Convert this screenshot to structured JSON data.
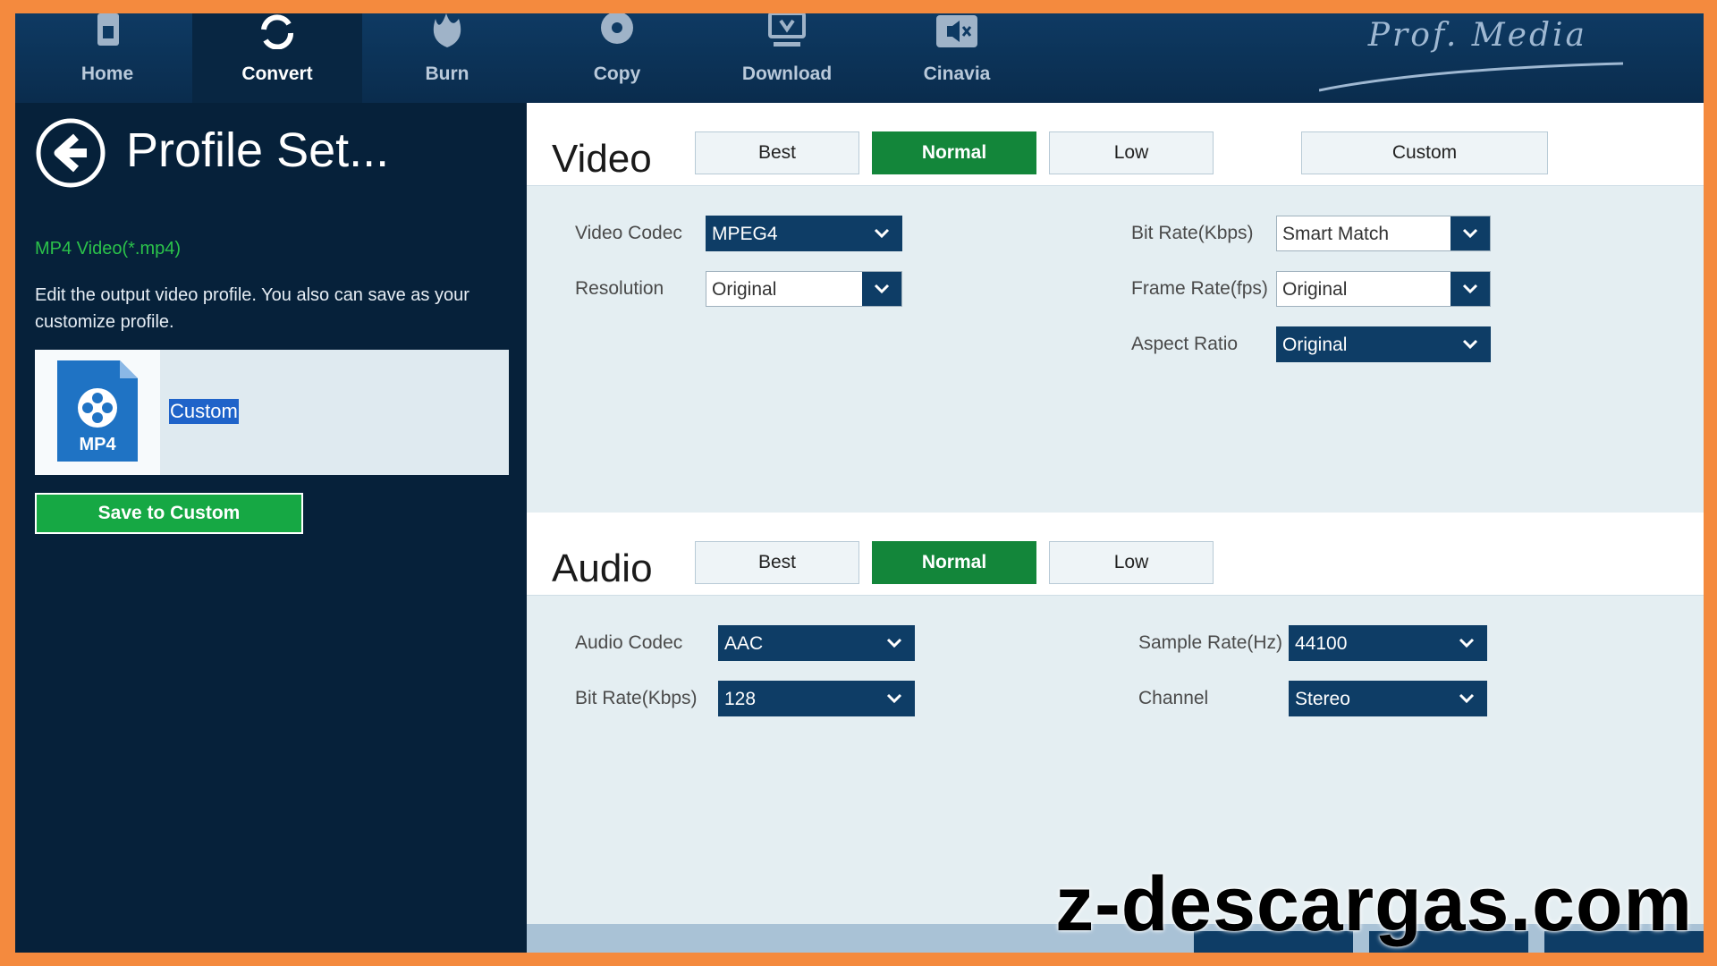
{
  "nav": {
    "items": [
      {
        "label": "Home",
        "icon": "home-icon"
      },
      {
        "label": "Convert",
        "icon": "convert-icon"
      },
      {
        "label": "Burn",
        "icon": "burn-icon"
      },
      {
        "label": "Copy",
        "icon": "copy-icon"
      },
      {
        "label": "Download",
        "icon": "download-icon"
      },
      {
        "label": "Cinavia",
        "icon": "cinavia-icon"
      }
    ],
    "active": "Convert",
    "brand": "Prof. Media"
  },
  "left": {
    "title": "Profile Set...",
    "format": "MP4 Video(*.mp4)",
    "description": "Edit the output video profile. You also can save as your customize profile.",
    "file_badge": "MP4",
    "profile_name": "Custom",
    "save_label": "Save to Custom"
  },
  "video": {
    "title": "Video",
    "presets": [
      "Best",
      "Normal",
      "Low",
      "Custom"
    ],
    "active_preset": "Normal",
    "codec_label": "Video Codec",
    "codec_value": "MPEG4",
    "resolution_label": "Resolution",
    "resolution_value": "Original",
    "bitrate_label": "Bit Rate(Kbps)",
    "bitrate_value": "Smart Match",
    "framerate_label": "Frame Rate(fps)",
    "framerate_value": "Original",
    "aspect_label": "Aspect Ratio",
    "aspect_value": "Original"
  },
  "audio": {
    "title": "Audio",
    "presets": [
      "Best",
      "Normal",
      "Low"
    ],
    "active_preset": "Normal",
    "codec_label": "Audio Codec",
    "codec_value": "AAC",
    "bitrate_label": "Bit Rate(Kbps)",
    "bitrate_value": "128",
    "samplerate_label": "Sample Rate(Hz)",
    "samplerate_value": "44100",
    "channel_label": "Channel",
    "channel_value": "Stereo"
  },
  "watermark": "z-descargas.com",
  "colors": {
    "accent_green": "#13863a",
    "nav_blue": "#0e3a63",
    "frame_orange": "#f48a3e"
  }
}
